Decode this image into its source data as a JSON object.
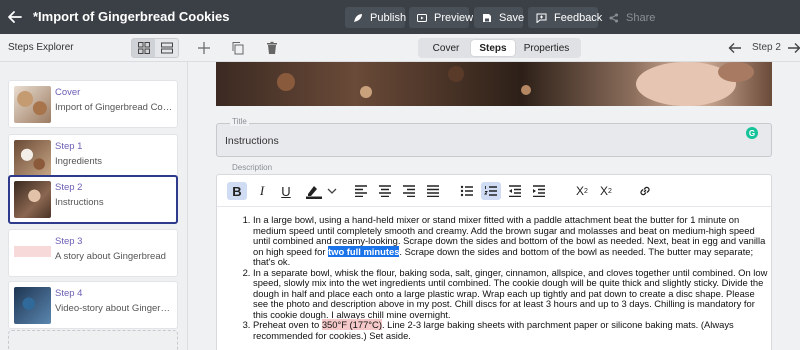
{
  "header": {
    "title": "*Import of Gingerbread Cookies",
    "buttons": {
      "publish": "Publish",
      "preview": "Preview",
      "save": "Save",
      "feedback": "Feedback",
      "share": "Share"
    }
  },
  "toolbar2": {
    "explorer_label": "Steps Explorer",
    "tabs": [
      "Cover",
      "Steps",
      "Properties"
    ],
    "active_tab": "Steps",
    "step_indicator": "Step 2"
  },
  "sidebar": {
    "items": [
      {
        "title": "Cover",
        "subtitle": "Import of Gingerbread Cookies"
      },
      {
        "title": "Step 1",
        "subtitle": "Ingredients"
      },
      {
        "title": "Step 2",
        "subtitle": "Instructions"
      },
      {
        "title": "Step 3",
        "subtitle": "A story about Gingerbread"
      },
      {
        "title": "Step 4",
        "subtitle": "Video-story about Gingerbread"
      }
    ]
  },
  "editor": {
    "title_label": "Title",
    "title_value": "Instructions",
    "description_label": "Description",
    "steps": {
      "s1_before": "In a large bowl, using a hand-held mixer or stand mixer fitted with a paddle attachment beat the butter for 1 minute on medium speed until completely smooth and creamy. Add the brown sugar and molasses and beat on medium-high speed until combined and creamy-looking. Scrape down the sides and bottom of the bowl as needed. Next, beat in egg and vanilla on high speed for ",
      "s1_selected": "two full minutes",
      "s1_after": ". Scrape down the sides and bottom of the bowl as needed. The butter may separate; that's ok.",
      "s2": "In a separate bowl, whisk the flour, baking soda, salt, ginger, cinnamon, allspice, and cloves together until combined. On low speed, slowly mix into the wet ingredients until combined. The cookie dough will be quite thick and slightly sticky. Divide the dough in half and place each onto a large plastic wrap. Wrap each up tightly and pat down to create a disc shape. Please see the photo and description above in my post. Chill discs for at least 3 hours and up to 3 days. Chilling is mandatory for this cookie dough. I always chill mine overnight.",
      "s3_before": "Preheat oven to ",
      "s3_highlight": "350°F (177°C)",
      "s3_after": ". Line 2-3 large baking sheets with parchment paper or silicone baking mats. (Always recommended for cookies.) Set aside."
    }
  },
  "colors": {
    "topbar": "#3b4047",
    "selected_border": "#2e3a8c",
    "step_title": "#6b5fb4",
    "selection": "#1a73e8",
    "grammarly": "#15c39a"
  }
}
